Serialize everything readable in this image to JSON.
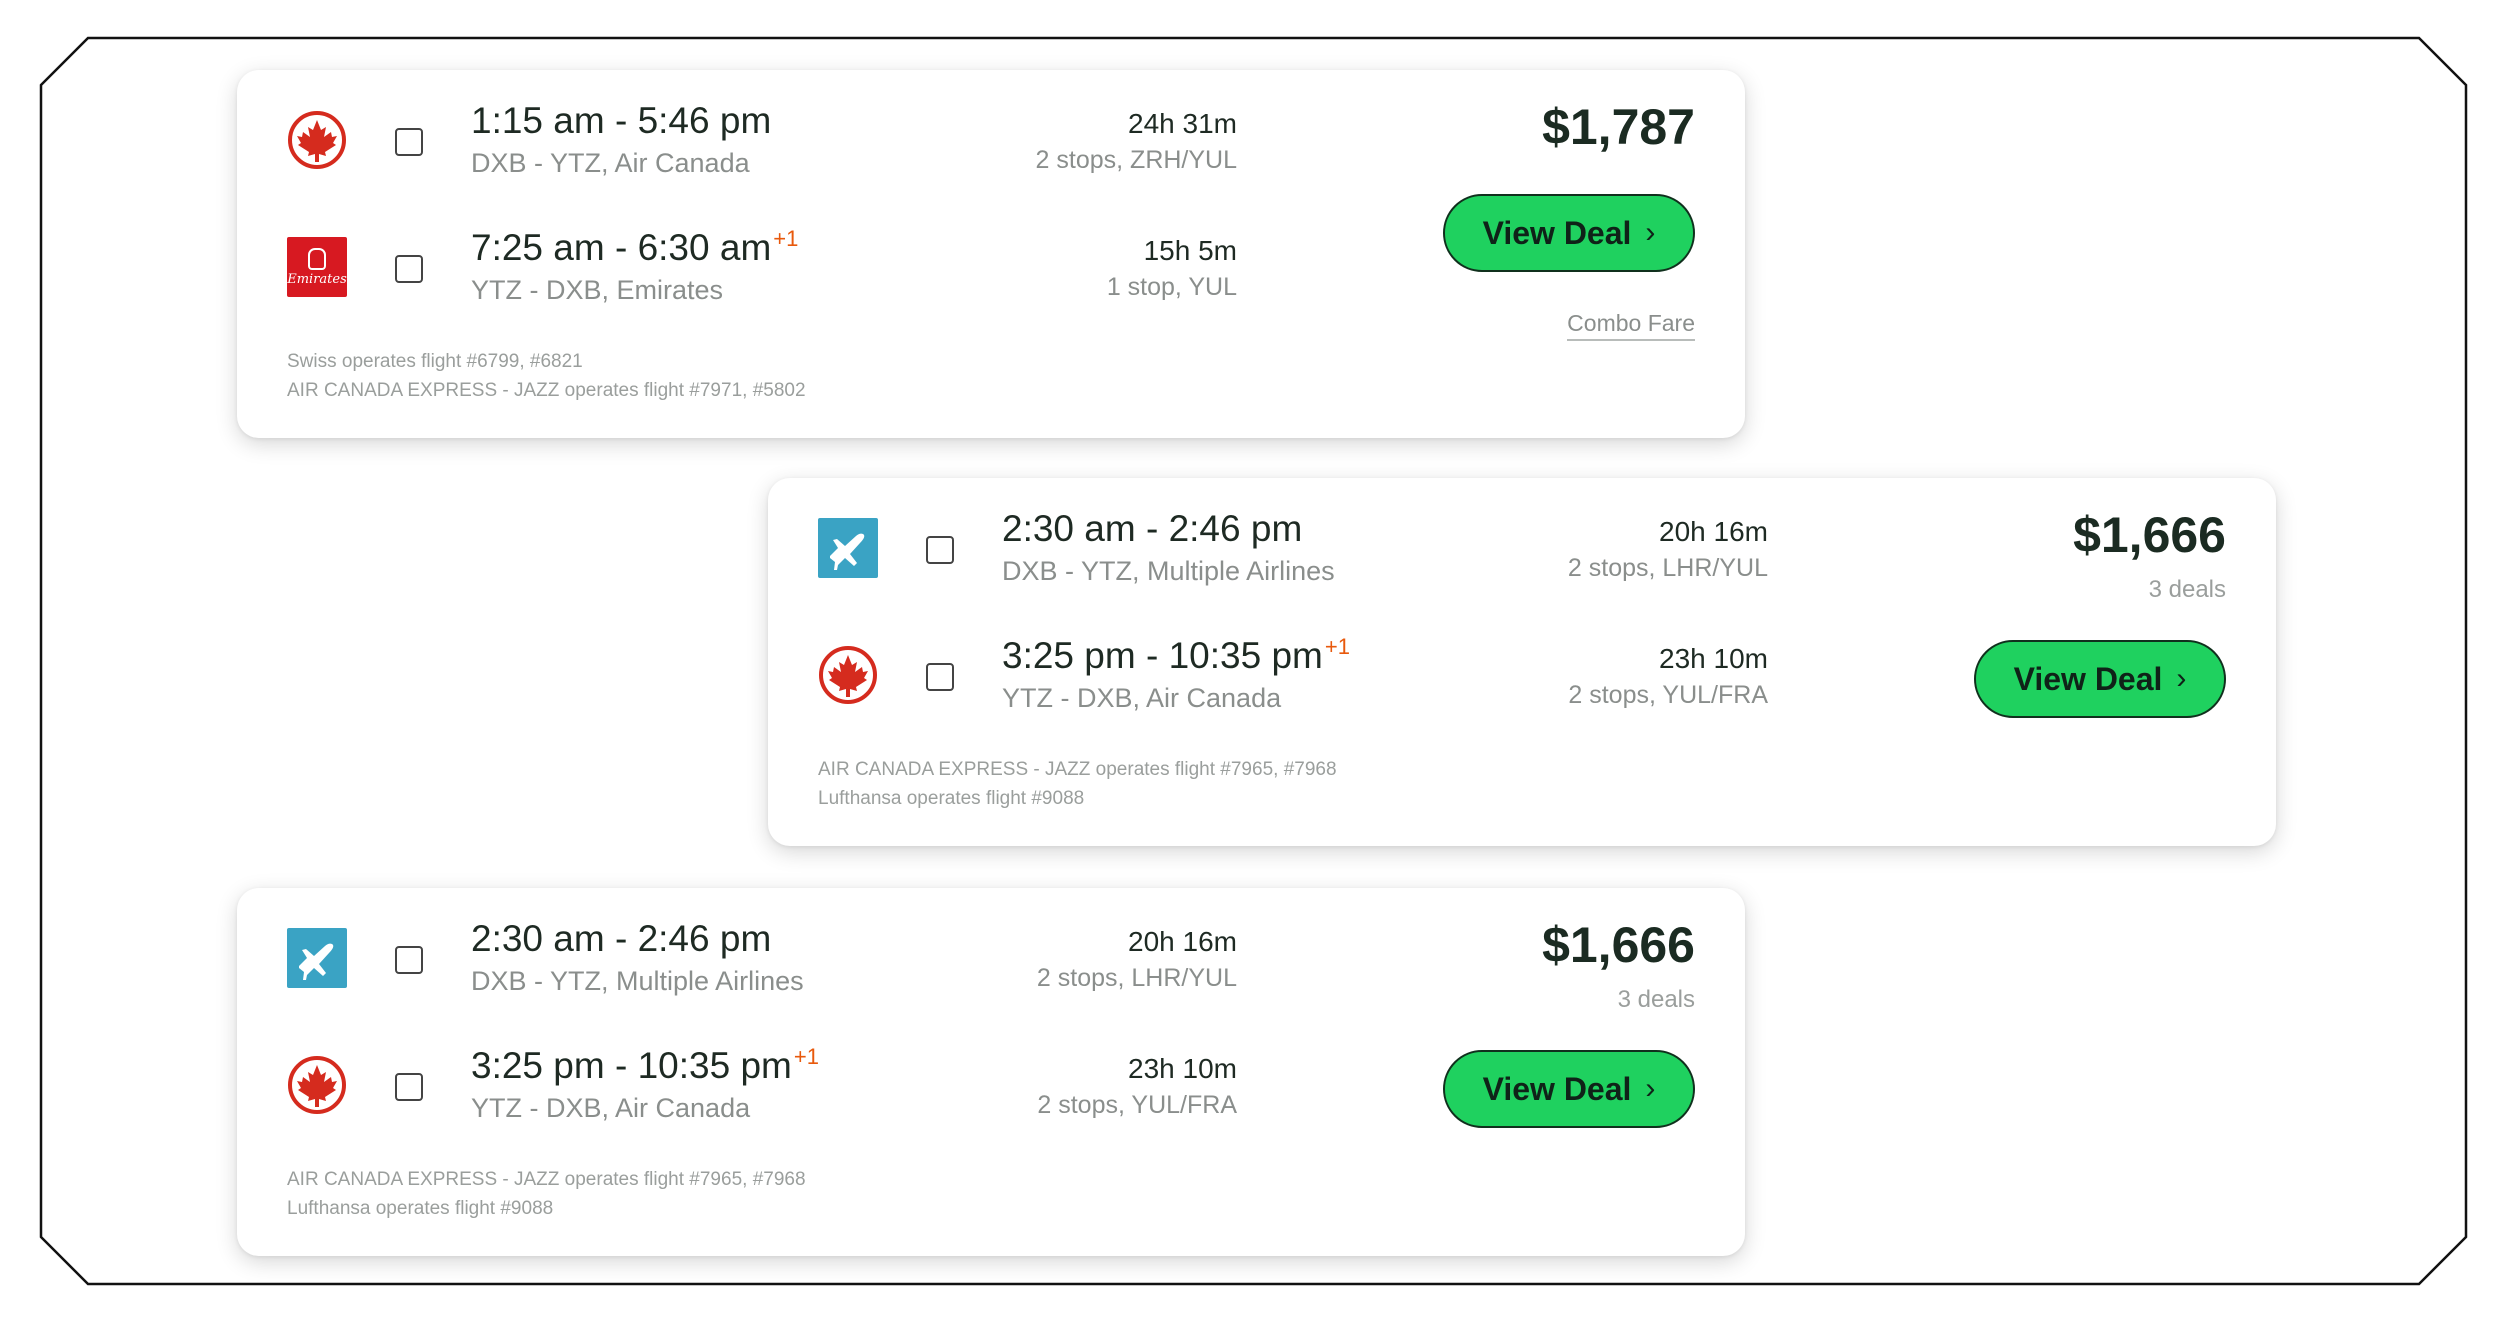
{
  "colors": {
    "accent_button": "#1fd15f",
    "plus_day": "#e8590c",
    "air_canada_red": "#d52b1e",
    "emirates_red": "#d71921",
    "multiple_airlines_blue": "#3aa3c4"
  },
  "cards": [
    {
      "price": "$1,787",
      "deals": "",
      "button_label": "View Deal",
      "combo_label": "Combo Fare",
      "legs": [
        {
          "airline_icon": "air-canada-logo",
          "times": "1:15 am - 5:46 pm",
          "plus_day": "",
          "route": "DXB - YTZ, Air Canada",
          "duration": "24h 31m",
          "stops": "2 stops, ZRH/YUL"
        },
        {
          "airline_icon": "emirates-logo",
          "logo_text": "Emirates",
          "times": "7:25 am - 6:30 am",
          "plus_day": "+1",
          "route": "YTZ - DXB, Emirates",
          "duration": "15h 5m",
          "stops": "1 stop, YUL"
        }
      ],
      "notes": [
        "Swiss operates flight #6799, #6821",
        "AIR CANADA EXPRESS - JAZZ operates flight #7971, #5802"
      ]
    },
    {
      "price": "$1,666",
      "deals": "3 deals",
      "button_label": "View Deal",
      "legs": [
        {
          "airline_icon": "multiple-airlines-plane-icon",
          "times": "2:30 am - 2:46 pm",
          "plus_day": "",
          "route": "DXB - YTZ, Multiple Airlines",
          "duration": "20h 16m",
          "stops": "2 stops, LHR/YUL"
        },
        {
          "airline_icon": "air-canada-logo",
          "times": "3:25 pm - 10:35 pm",
          "plus_day": "+1",
          "route": "YTZ - DXB, Air Canada",
          "duration": "23h 10m",
          "stops": "2 stops, YUL/FRA"
        }
      ],
      "notes": [
        "AIR CANADA EXPRESS - JAZZ operates flight #7965, #7968",
        "Lufthansa operates flight #9088"
      ]
    },
    {
      "price": "$1,666",
      "deals": "3 deals",
      "button_label": "View Deal",
      "legs": [
        {
          "airline_icon": "multiple-airlines-plane-icon",
          "times": "2:30 am - 2:46 pm",
          "plus_day": "",
          "route": "DXB - YTZ, Multiple Airlines",
          "duration": "20h 16m",
          "stops": "2 stops, LHR/YUL"
        },
        {
          "airline_icon": "air-canada-logo",
          "times": "3:25 pm - 10:35 pm",
          "plus_day": "+1",
          "route": "YTZ - DXB, Air Canada",
          "duration": "23h 10m",
          "stops": "2 stops, YUL/FRA"
        }
      ],
      "notes": [
        "AIR CANADA EXPRESS - JAZZ operates flight #7965, #7968",
        "Lufthansa operates flight #9088"
      ]
    }
  ]
}
